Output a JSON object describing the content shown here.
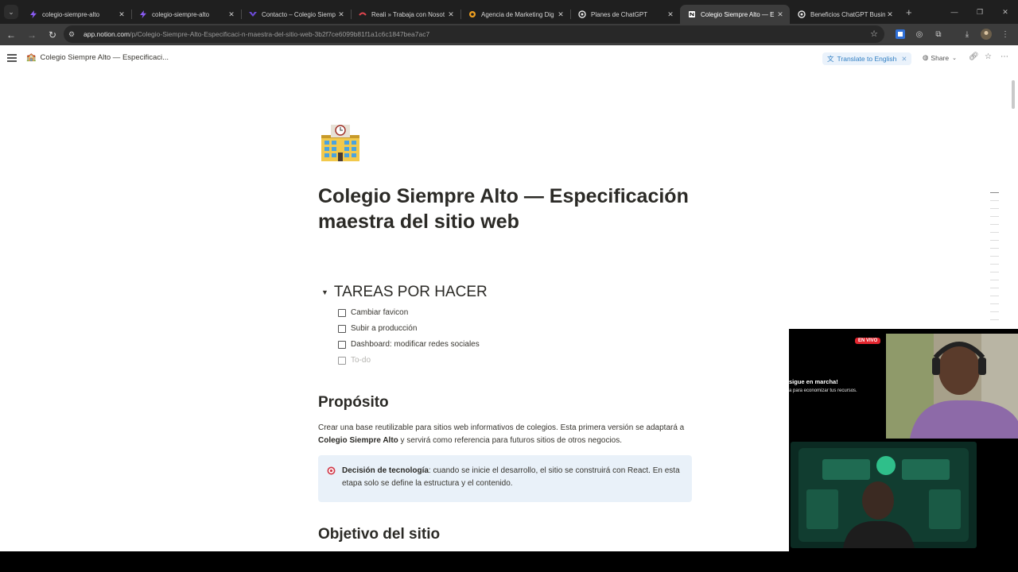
{
  "browser": {
    "tabs": [
      {
        "title": "colegio-siempre-alto",
        "favicon": "purple-bolt-icon",
        "active": false
      },
      {
        "title": "colegio-siempre-alto",
        "favicon": "purple-bolt-icon",
        "active": false
      },
      {
        "title": "Contacto – Colegio Siemp",
        "favicon": "purple-logo-icon",
        "active": false
      },
      {
        "title": "Reali » Trabaja con Nosot",
        "favicon": "red-logo-icon",
        "active": false
      },
      {
        "title": "Agencia de Marketing Dig",
        "favicon": "orange-logo-icon",
        "active": false
      },
      {
        "title": "Planes de ChatGPT",
        "favicon": "openai-icon",
        "active": false
      },
      {
        "title": "Colegio Siempre Alto — E",
        "favicon": "notion-icon",
        "active": true
      },
      {
        "title": "Beneficios ChatGPT Busin",
        "favicon": "openai-icon",
        "active": false
      }
    ],
    "url_host": "app.notion.com",
    "url_path": "/p/Colegio-Siempre-Alto-Especificaci-n-maestra-del-sitio-web-3b2f7ce6099b81f1a1c6c1847bea7ac7"
  },
  "notion": {
    "breadcrumb": "Colegio Siempre Alto — Especificaci...",
    "translate_label": "Translate to English",
    "share_label": "Share",
    "page_title": "Colegio Siempre Alto — Especificación maestra del sitio web",
    "todo_heading": "TAREAS POR HACER",
    "todos": [
      "Cambiar favicon",
      "Subir a producción",
      "Dashboard: modificar redes sociales"
    ],
    "todo_placeholder": "To-do",
    "section1_heading": "Propósito",
    "para1_part1": "Crear una base reutilizable para sitios web informativos de colegios. Esta primera versión se adaptará a ",
    "para1_bold": "Colegio Siempre Alto",
    "para1_part2": " y servirá como referencia para futuros sitios de otros negocios.",
    "callout_bold": "Decisión de tecnología",
    "callout_text": ": cuando se inicie el desarrollo, el sitio se construirá con React. En esta etapa solo se define la estructura y el contenido.",
    "section2_heading": "Objetivo del sitio"
  },
  "stream": {
    "live_badge": "EN VIVO",
    "promo_line1": "sigue en marcha!",
    "promo_line2": "a para economizar tus recursos."
  },
  "colors": {
    "tab_bar": "#1f1f1f",
    "toolbar": "#3c3c3c",
    "callout_bg": "#e9f1f9",
    "translate_blue": "#2f7ec2",
    "live_red": "#e3262f"
  }
}
